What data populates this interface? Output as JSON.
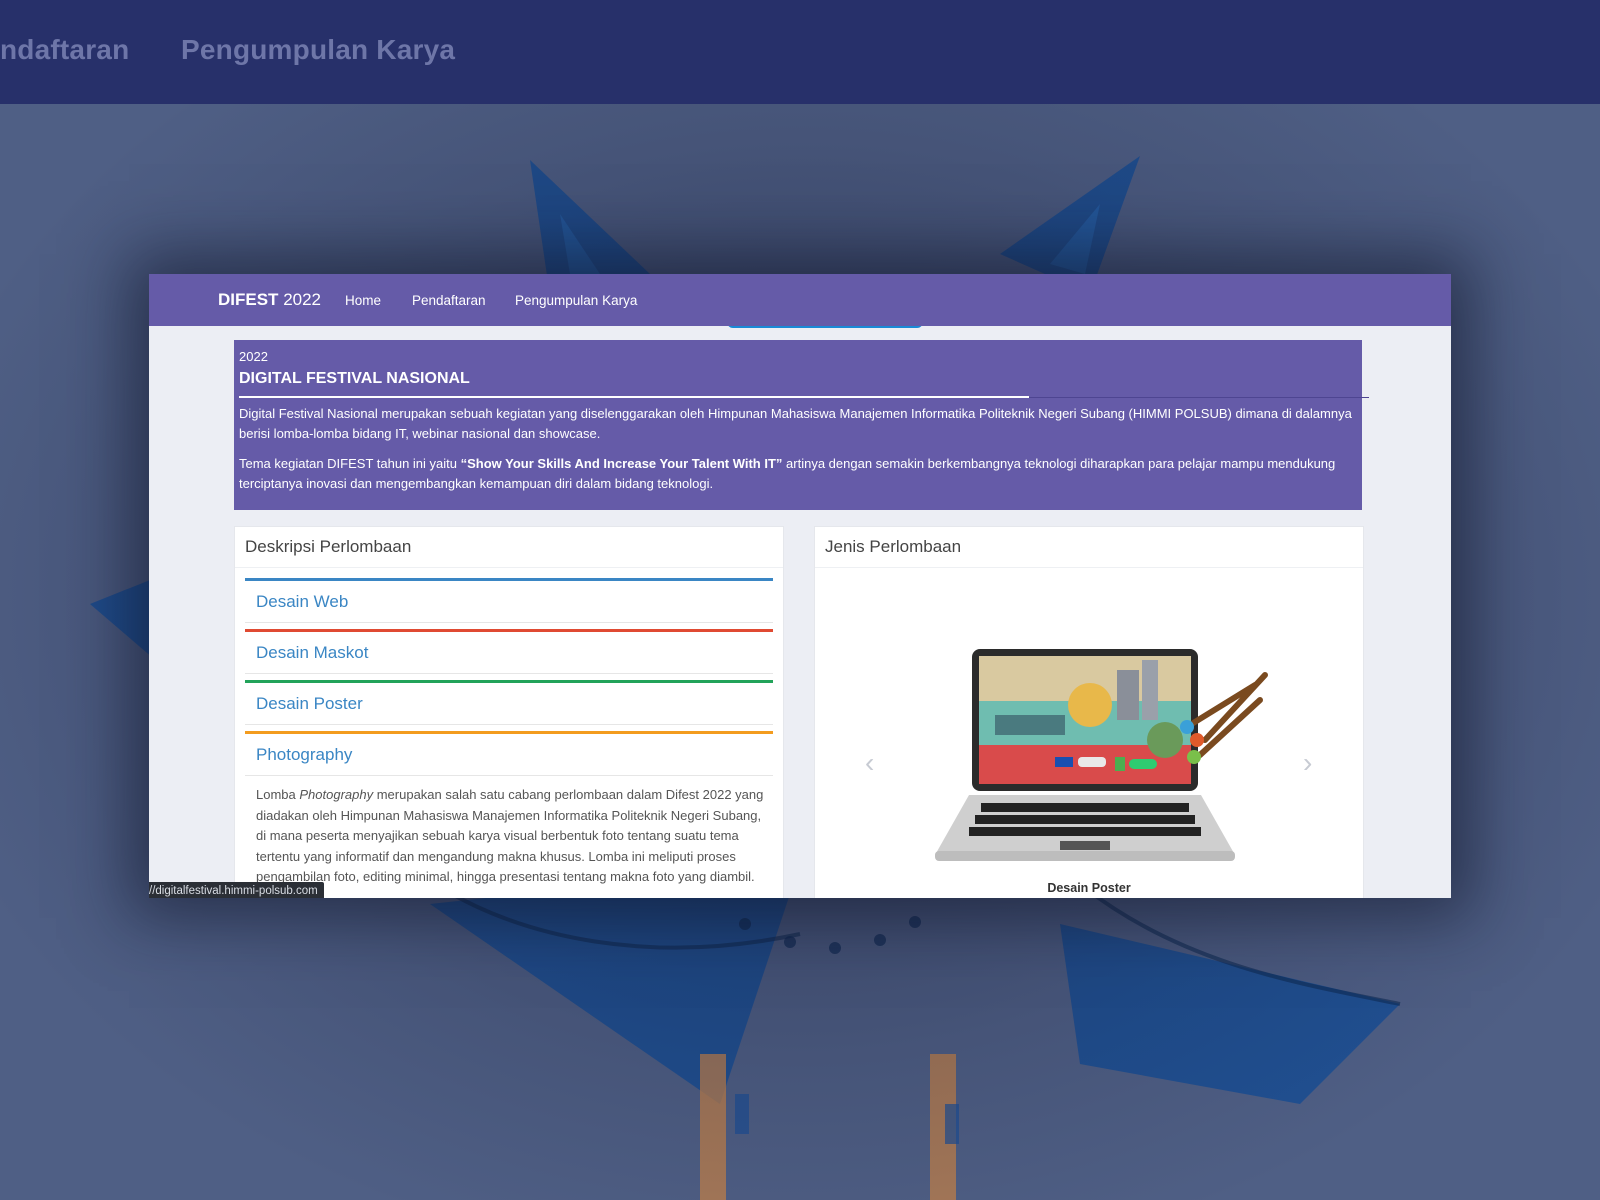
{
  "background": {
    "nav_items": [
      "ndaftaran",
      "Pengumpulan Karya"
    ]
  },
  "site": {
    "brand_bold": "DIFEST",
    "brand_year": "2022",
    "nav": [
      "Home",
      "Pendaftaran",
      "Pengumpulan Karya"
    ]
  },
  "hero": {
    "year": "2022",
    "title": "DIGITAL FESTIVAL NASIONAL",
    "paragraph1": "Digital Festival Nasional merupakan sebuah kegiatan yang diselenggarakan oleh Himpunan Mahasiswa Manajemen Informatika Politeknik Negeri Subang (HIMMI POLSUB) dimana di dalamnya berisi lomba-lomba bidang IT, webinar nasional dan showcase.",
    "paragraph2_prefix": "Tema kegiatan DIFEST tahun ini yaitu ",
    "paragraph2_theme": "“Show Your Skills And Increase Your Talent With IT”",
    "paragraph2_suffix": " artinya dengan semakin berkembangnya teknologi diharapkan para pelajar mampu mendukung terciptanya inovasi dan mengembangkan kemampuan diri dalam bidang teknologi."
  },
  "deskripsi": {
    "title": "Deskripsi Perlombaan",
    "items": [
      {
        "label": "Desain Web",
        "color": "#3a86c4"
      },
      {
        "label": "Desain Maskot",
        "color": "#e04a32"
      },
      {
        "label": "Desain Poster",
        "color": "#22a35a"
      },
      {
        "label": "Photography",
        "color": "#f39c1f"
      }
    ],
    "desc_prefix": "Lomba ",
    "desc_italic": "Photography",
    "desc_rest": " merupakan salah satu cabang perlombaan dalam Difest 2022 yang diadakan oleh Himpunan Mahasiswa Manajemen Informatika Politeknik Negeri Subang, di mana peserta menyajikan sebuah karya visual berbentuk foto tentang suatu tema tertentu yang informatif dan mengandung makna khusus. Lomba ini meliputi proses pengambilan foto, editing minimal, hingga presentasi tentang makna foto yang diambil."
  },
  "jenis": {
    "title": "Jenis Perlombaan",
    "caption": "Desain Poster",
    "prev_icon": "chevron-left-icon",
    "next_icon": "chevron-right-icon"
  },
  "status_bar": {
    "url": "//digitalfestival.himmi-polsub.com"
  }
}
